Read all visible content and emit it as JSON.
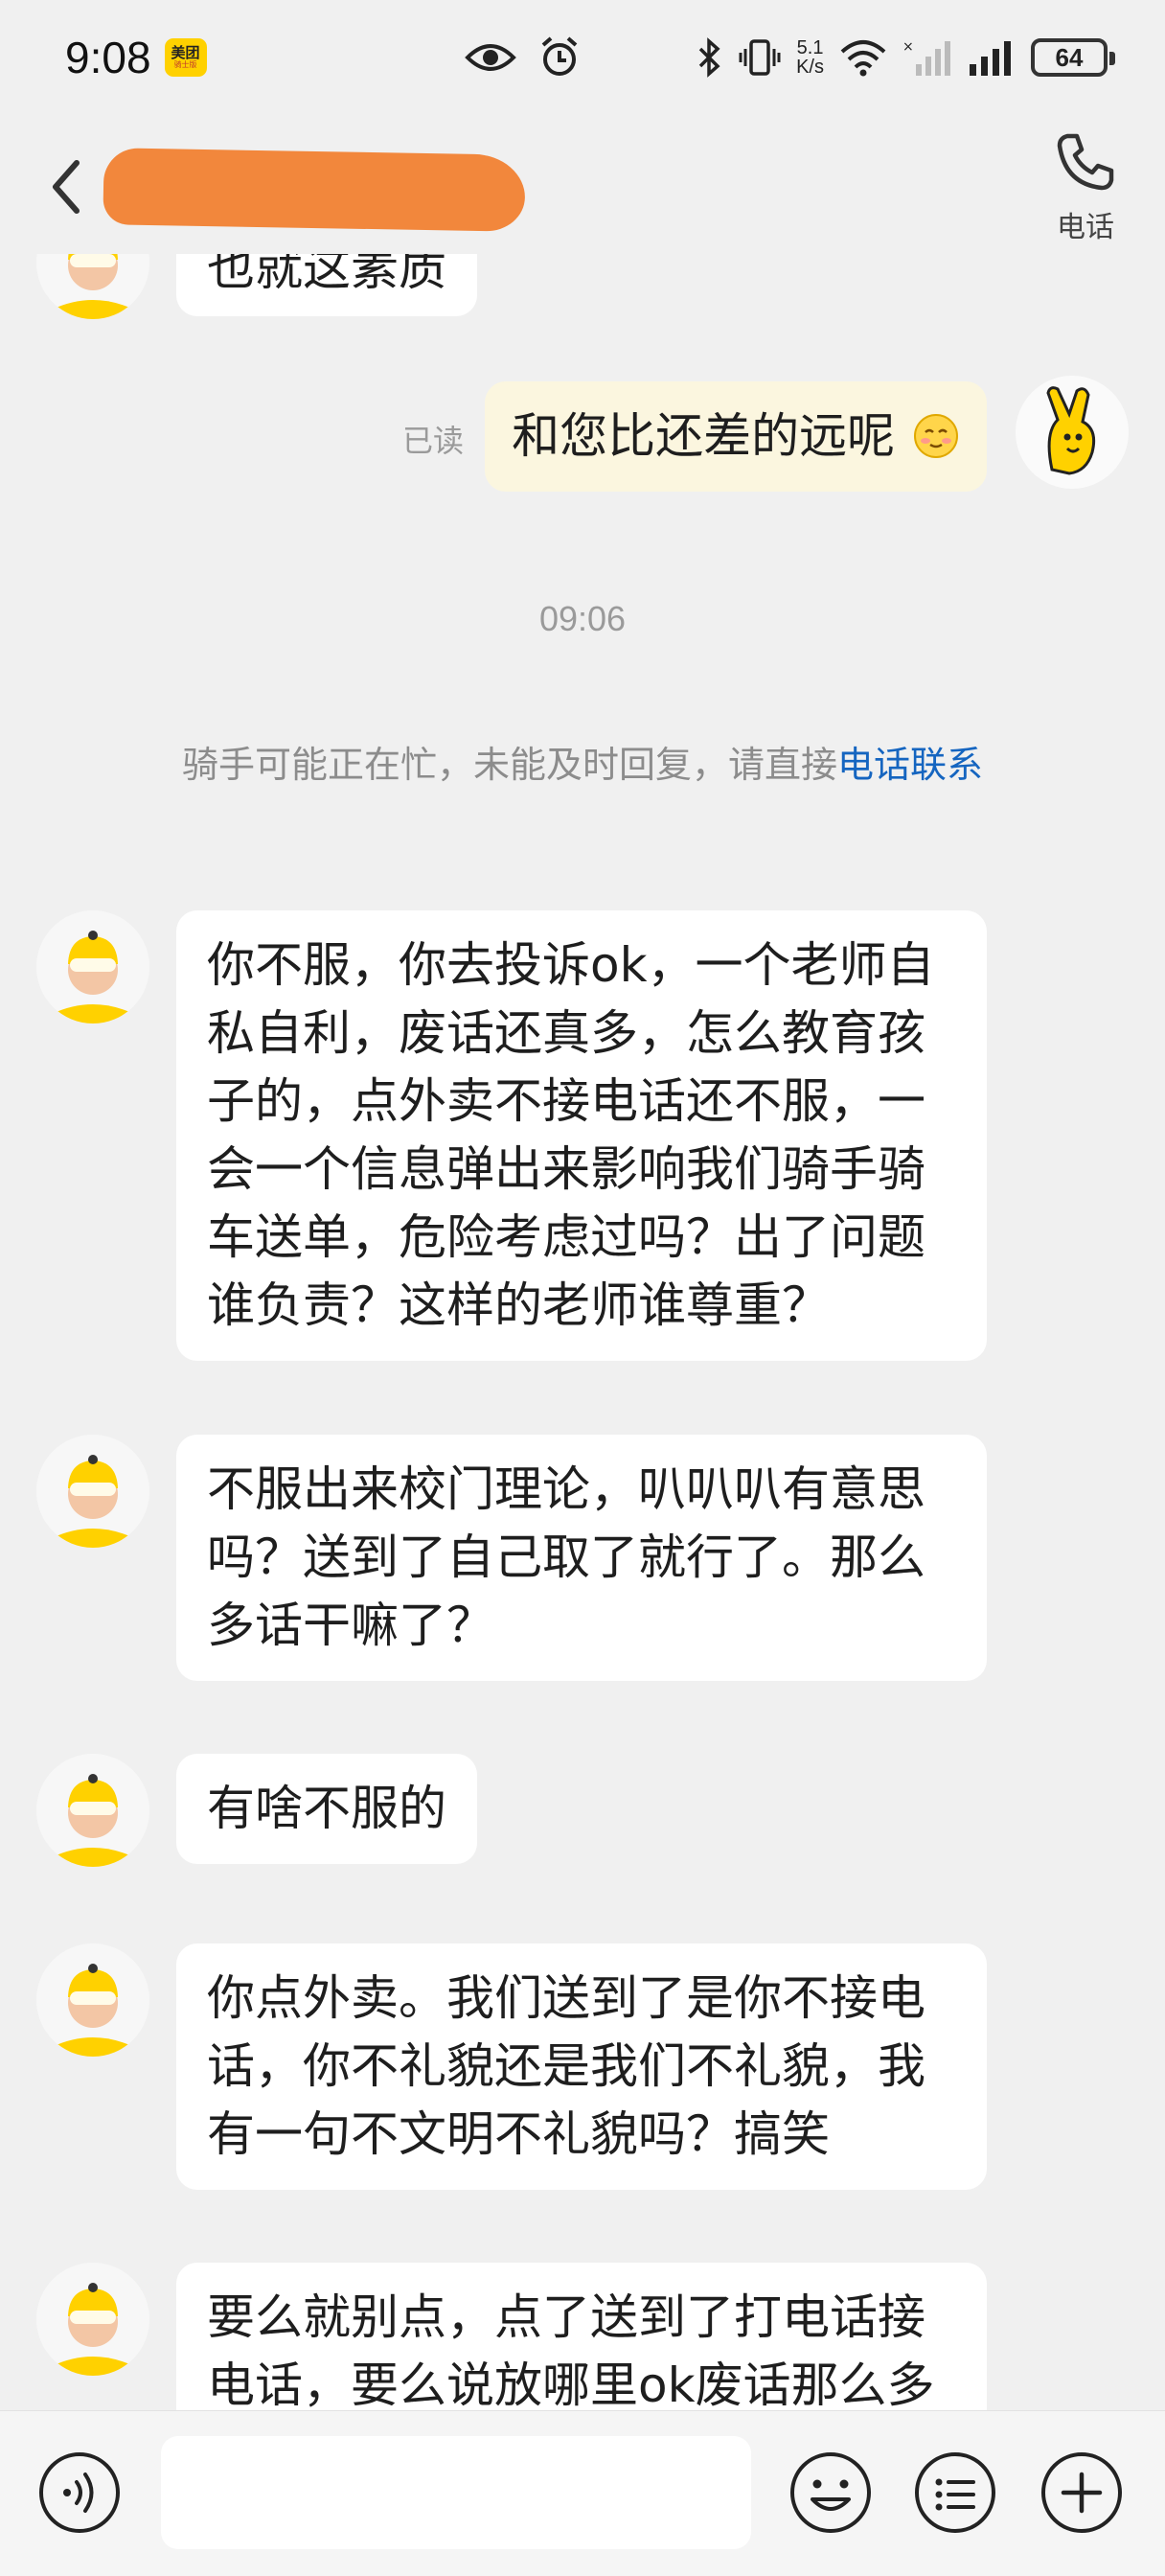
{
  "status_bar": {
    "time": "9:08",
    "app_badge": "美团",
    "app_badge_sub": "骑士版",
    "net_speed_value": "5.1",
    "net_speed_unit": "K/s",
    "battery": "64",
    "icons": [
      "eye-icon",
      "alarm-icon",
      "bluetooth-icon",
      "vibrate-icon",
      "wifi-icon",
      "signal-icon",
      "signal-icon"
    ]
  },
  "header": {
    "call_label": "电话"
  },
  "messages": {
    "partial_text": "也就这素质",
    "mine_text": "和您比还差的远呢",
    "read_label": "已读",
    "time": "09:06",
    "notice_prefix": "骑手可能正在忙，未能及时回复，请直接",
    "notice_link": "电话联系",
    "m1": "你不服，你去投诉ok，一个老师自私自利，废话还真多，怎么教育孩子的，点外卖不接电话还不服，一会一个信息弹出来影响我们骑手骑车送单，危险考虑过吗？出了问题谁负责？这样的老师谁尊重？",
    "m2": "不服出来校门理论，叭叭叭有意思吗？送到了自己取了就行了。那么多话干嘛了？",
    "m3": "有啥不服的",
    "m4": "你点外卖。我们送到了是你不接电话，你不礼貌还是我们不礼貌，我有一句不文明不礼貌吗？搞笑",
    "m5": "要么就别点，点了送到了打电话接电话，要么说放哪里ok废话那么多"
  },
  "input_bar": {
    "placeholder": ""
  },
  "colors": {
    "background": "#f0f0f0",
    "bubble_other": "#ffffff",
    "bubble_mine": "#fbf6df",
    "link": "#1565c0",
    "redaction": "#f2873c",
    "meituan_yellow": "#ffd100"
  }
}
